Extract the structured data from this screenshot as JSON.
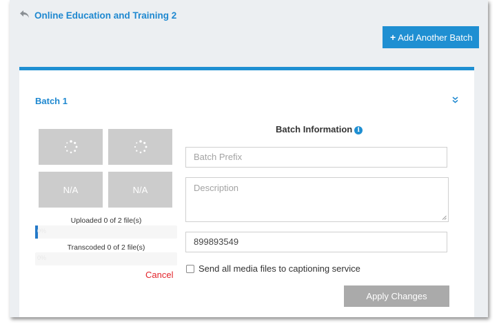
{
  "header": {
    "back_icon": "undo-arrow-icon",
    "title": "Online Education and Training 2"
  },
  "toolbar": {
    "add_batch_label": "Add Another Batch",
    "add_batch_icon": "plus-icon"
  },
  "batch": {
    "title": "Batch 1",
    "collapse_icon": "double-chevron-down-icon",
    "thumbnails": [
      {
        "state": "loading",
        "icon": "spinner-icon"
      },
      {
        "state": "loading",
        "icon": "spinner-icon"
      },
      {
        "label": "N/A"
      },
      {
        "label": "N/A"
      }
    ],
    "uploaded_label": "Uploaded 0 of 2 file(s)",
    "upload_progress_pct": 2,
    "transcoded_label": "Transcoded 0 of 2 file(s)",
    "transcode_progress_pct": 0,
    "progress_text": "0%",
    "cancel_label": "Cancel"
  },
  "info": {
    "heading": "Batch Information",
    "info_icon": "info-circle-icon",
    "batch_prefix_placeholder": "Batch Prefix",
    "description_placeholder": "Description",
    "id_value": "899893549",
    "captioning_label": "Send all media files to captioning service",
    "captioning_checked": false,
    "apply_label": "Apply Changes"
  },
  "colors": {
    "accent": "#1f8fd2",
    "cancel": "#e2232a",
    "disabled_button": "#aaaaaa"
  }
}
